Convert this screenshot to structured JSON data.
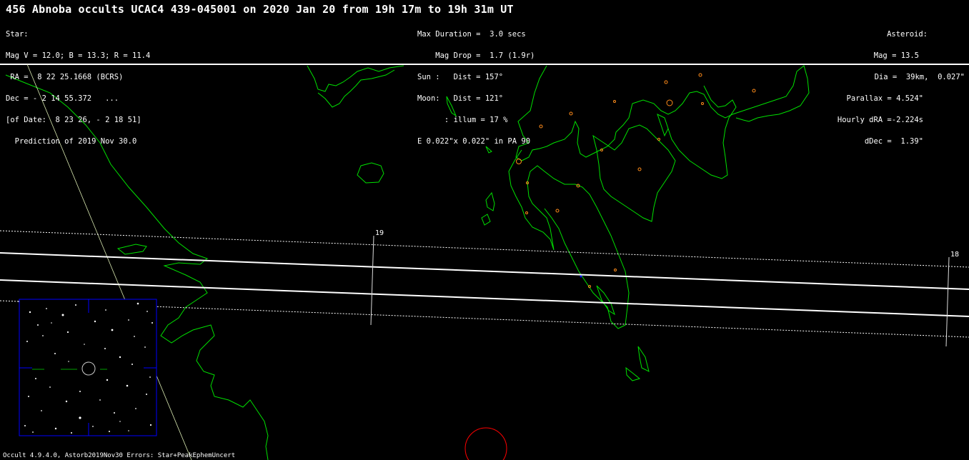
{
  "title": "456 Abnoba occults UCAC4 439-045001 on 2020 Jan 20 from 19h 17m to 19h 31m UT",
  "star": {
    "lines": [
      "Star:",
      "Mag V = 12.0; B = 13.3; R = 11.4",
      " RA =  8 22 25.1668 (BCRS)",
      "Dec = - 2 14 55.372   ...",
      "[of Date:  8 23 26, - 2 18 51]",
      "  Prediction of 2019 Nov 30.0"
    ]
  },
  "event": {
    "lines": [
      "Max Duration =  3.0 secs",
      "    Mag Drop =  1.7 (1.9r)",
      "Sun :   Dist = 157°",
      "Moon:   Dist = 121°",
      "      : illum = 17 %",
      "E 0.022\"x 0.022\" in PA 90"
    ]
  },
  "asteroid": {
    "lines": [
      "Asteroid:",
      "Mag = 13.5",
      "Dia =  39km,  0.027\"",
      "Parallax = 4.524\"",
      "Hourly dRA =-2.224s",
      "dDec =  1.39\""
    ]
  },
  "hour_markers": [
    "19",
    "18"
  ],
  "footer": "Occult 4.9.4.0, Astorb2019Nov30 Errors: Star+PeakEphemUncert",
  "colors": {
    "background": "#000000",
    "coastline": "#00e000",
    "path_lines": "#ffffff",
    "site_markers": "#ff8c1a",
    "finder_frame": "#0000ff",
    "moon_circle": "#ff0000"
  }
}
